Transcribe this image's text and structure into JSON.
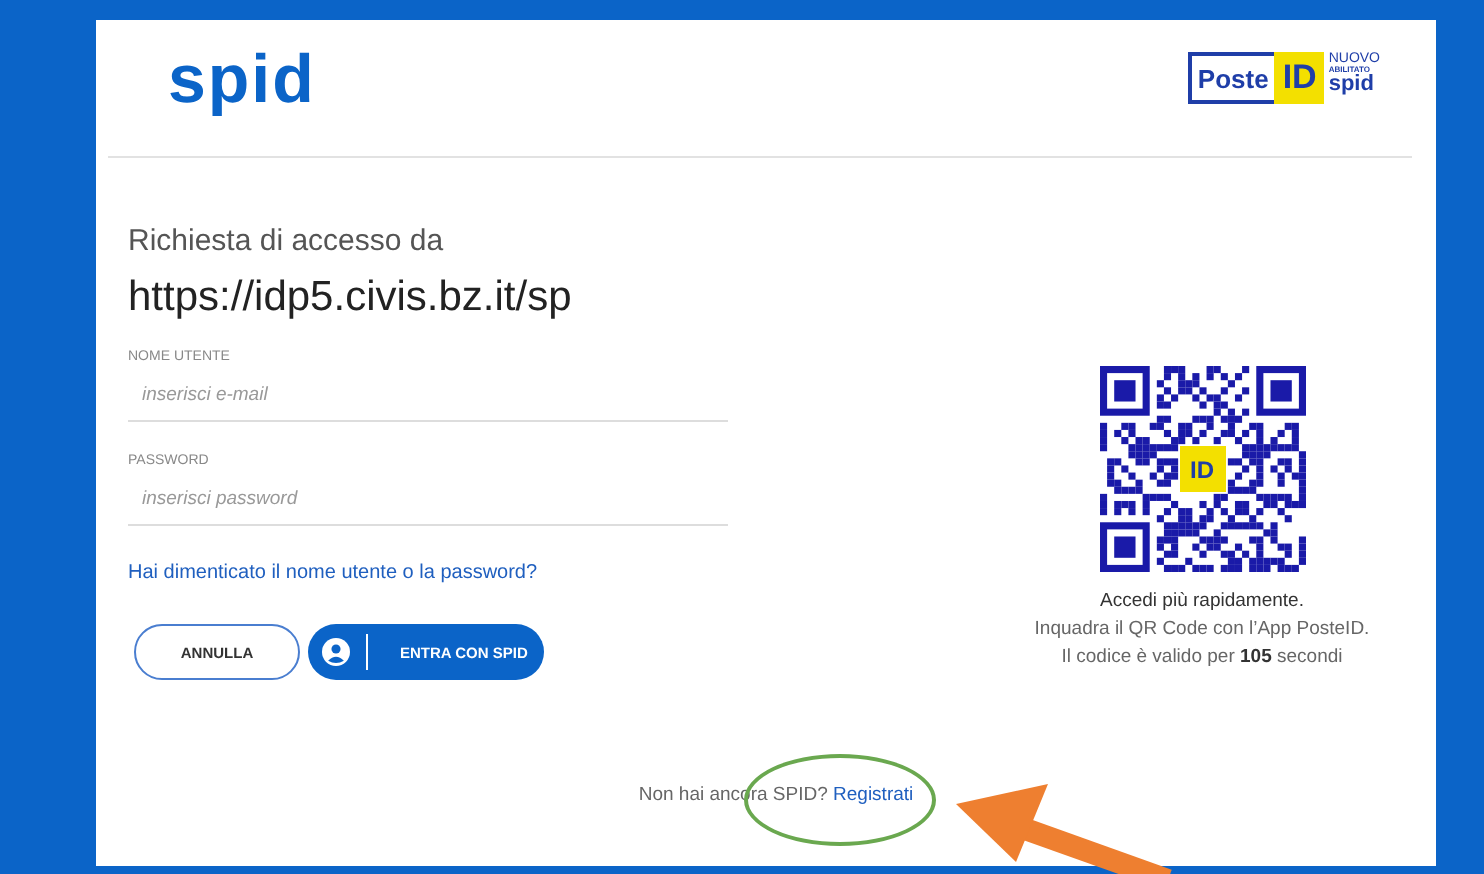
{
  "header": {
    "logo": "spid",
    "poste_logo": {
      "poste": "Poste",
      "id": "ID",
      "nuovo": "NUOVO",
      "abilitato": "ABILITATO",
      "spid": "spid"
    }
  },
  "request": {
    "title": "Richiesta di accesso da",
    "url": "https://idp5.civis.bz.it/sp"
  },
  "fields": [
    {
      "label": "NOME UTENTE",
      "placeholder": "inserisci e-mail"
    },
    {
      "label": "PASSWORD",
      "placeholder": "inserisci password"
    }
  ],
  "forgot_link": "Hai dimenticato il nome utente o la password?",
  "buttons": {
    "cancel": "ANNULLA",
    "login": "ENTRA CON SPID"
  },
  "qr": {
    "badge": "ID",
    "title": "Accedi più rapidamente.",
    "line": "Inquadra il QR Code con l’App PosteID.",
    "validity": "Il codice è valido per **105** secondi"
  },
  "footer": {
    "text": "Non hai ancora SPID? ",
    "link": "Registrati"
  }
}
